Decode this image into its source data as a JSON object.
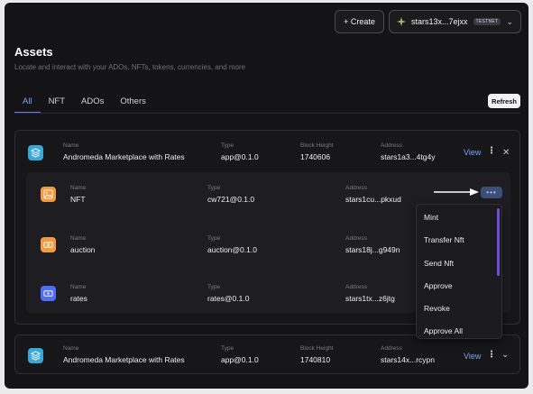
{
  "header": {
    "create_label": "+ Create",
    "wallet_address": "stars13x...7ejxx",
    "wallet_network": "TESTNET"
  },
  "page": {
    "title": "Assets",
    "subtitle": "Locate and interact with your ADOs, NFTs, tokens, currencies, and more"
  },
  "tabs": [
    {
      "label": "All",
      "active": true
    },
    {
      "label": "NFT",
      "active": false
    },
    {
      "label": "ADOs",
      "active": false
    },
    {
      "label": "Others",
      "active": false
    }
  ],
  "refresh_label": "Refresh",
  "labels": {
    "name": "Name",
    "type": "Type",
    "block_height": "Block Height",
    "address": "Address",
    "view": "View"
  },
  "apps": [
    {
      "name": "Andromeda Marketplace with Rates",
      "type": "app@0.1.0",
      "block_height": "1740606",
      "address": "stars1a3...4tg4y",
      "expanded": true,
      "components": [
        {
          "name": "NFT",
          "type": "cw721@0.1.0",
          "address": "stars1cu...pkxud",
          "icon": "image-icon",
          "color": "#f29a3f"
        },
        {
          "name": "auction",
          "type": "auction@0.1.0",
          "address": "stars18j...g949n",
          "icon": "ticket-icon",
          "color": "#f29a3f"
        },
        {
          "name": "rates",
          "type": "rates@0.1.0",
          "address": "stars1tx...z6jtg",
          "icon": "card-icon",
          "color": "#4f6df5"
        }
      ]
    },
    {
      "name": "Andromeda Marketplace with Rates",
      "type": "app@0.1.0",
      "block_height": "1740810",
      "address": "stars14x...rcypn",
      "expanded": false
    }
  ],
  "menu": {
    "items": [
      "Mint",
      "Transfer Nft",
      "Send Nft",
      "Approve",
      "Revoke",
      "Approve All"
    ]
  },
  "colors": {
    "accent": "#7aa2ff",
    "app_icon": "#3aa7d8",
    "menu_scrollbar": "#6c4fd6"
  }
}
